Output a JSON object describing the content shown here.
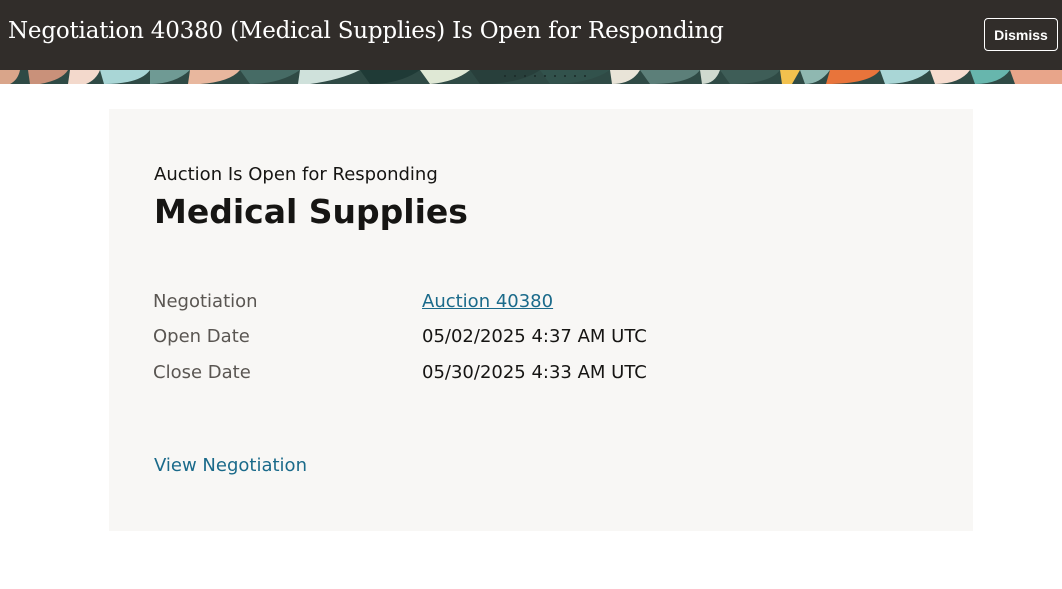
{
  "header": {
    "title": "Negotiation 40380 (Medical Supplies) Is Open for Responding",
    "dismiss_label": "Dismiss"
  },
  "card": {
    "eyebrow": "Auction Is Open for Responding",
    "title": "Medical Supplies",
    "rows": [
      {
        "label": "Negotiation",
        "value": "Auction 40380"
      },
      {
        "label": "Open Date",
        "value": "05/02/2025 4:37 AM UTC"
      },
      {
        "label": "Close Date",
        "value": "05/30/2025 4:33 AM UTC"
      }
    ],
    "view_link": "View Negotiation"
  },
  "colors": {
    "header_bg": "#312d2a",
    "card_bg": "#f8f7f5",
    "link": "#1a6a8a"
  }
}
